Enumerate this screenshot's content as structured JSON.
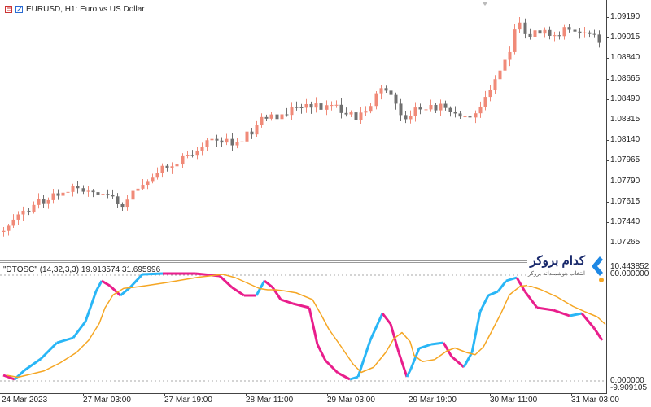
{
  "header": {
    "symbol_title": "EURUSD, H1:  Euro vs US Dollar"
  },
  "indicator": {
    "title": "\"DTOSC\" (14,32,3,3) 19.913574 31.695996",
    "axis_labels": [
      "10.443852",
      "00.000000",
      "0.000000",
      "-9.909105"
    ]
  },
  "logo": {
    "name": "کدام بروکر",
    "tagline": "انتخاب هوشمندانه بروکر"
  },
  "colors": {
    "bull_candle": "#f08a78",
    "bear_candle": "#707070",
    "osc_up": "#29b6f6",
    "osc_down": "#e91e8c",
    "signal": "#f5a623",
    "brand": "#1a2a6c",
    "brand_accent": "#1e88e5"
  },
  "price_axis": [
    "1.09190",
    "1.09015",
    "1.08840",
    "1.08665",
    "1.08490",
    "1.08315",
    "1.08140",
    "1.07965",
    "1.07790",
    "1.07615",
    "1.07440",
    "1.07265"
  ],
  "time_axis": [
    "24 Mar 2023",
    "27 Mar 03:00",
    "27 Mar 19:00",
    "28 Mar 11:00",
    "29 Mar 03:00",
    "29 Mar 19:00",
    "30 Mar 11:00",
    "31 Mar 03:00"
  ]
}
